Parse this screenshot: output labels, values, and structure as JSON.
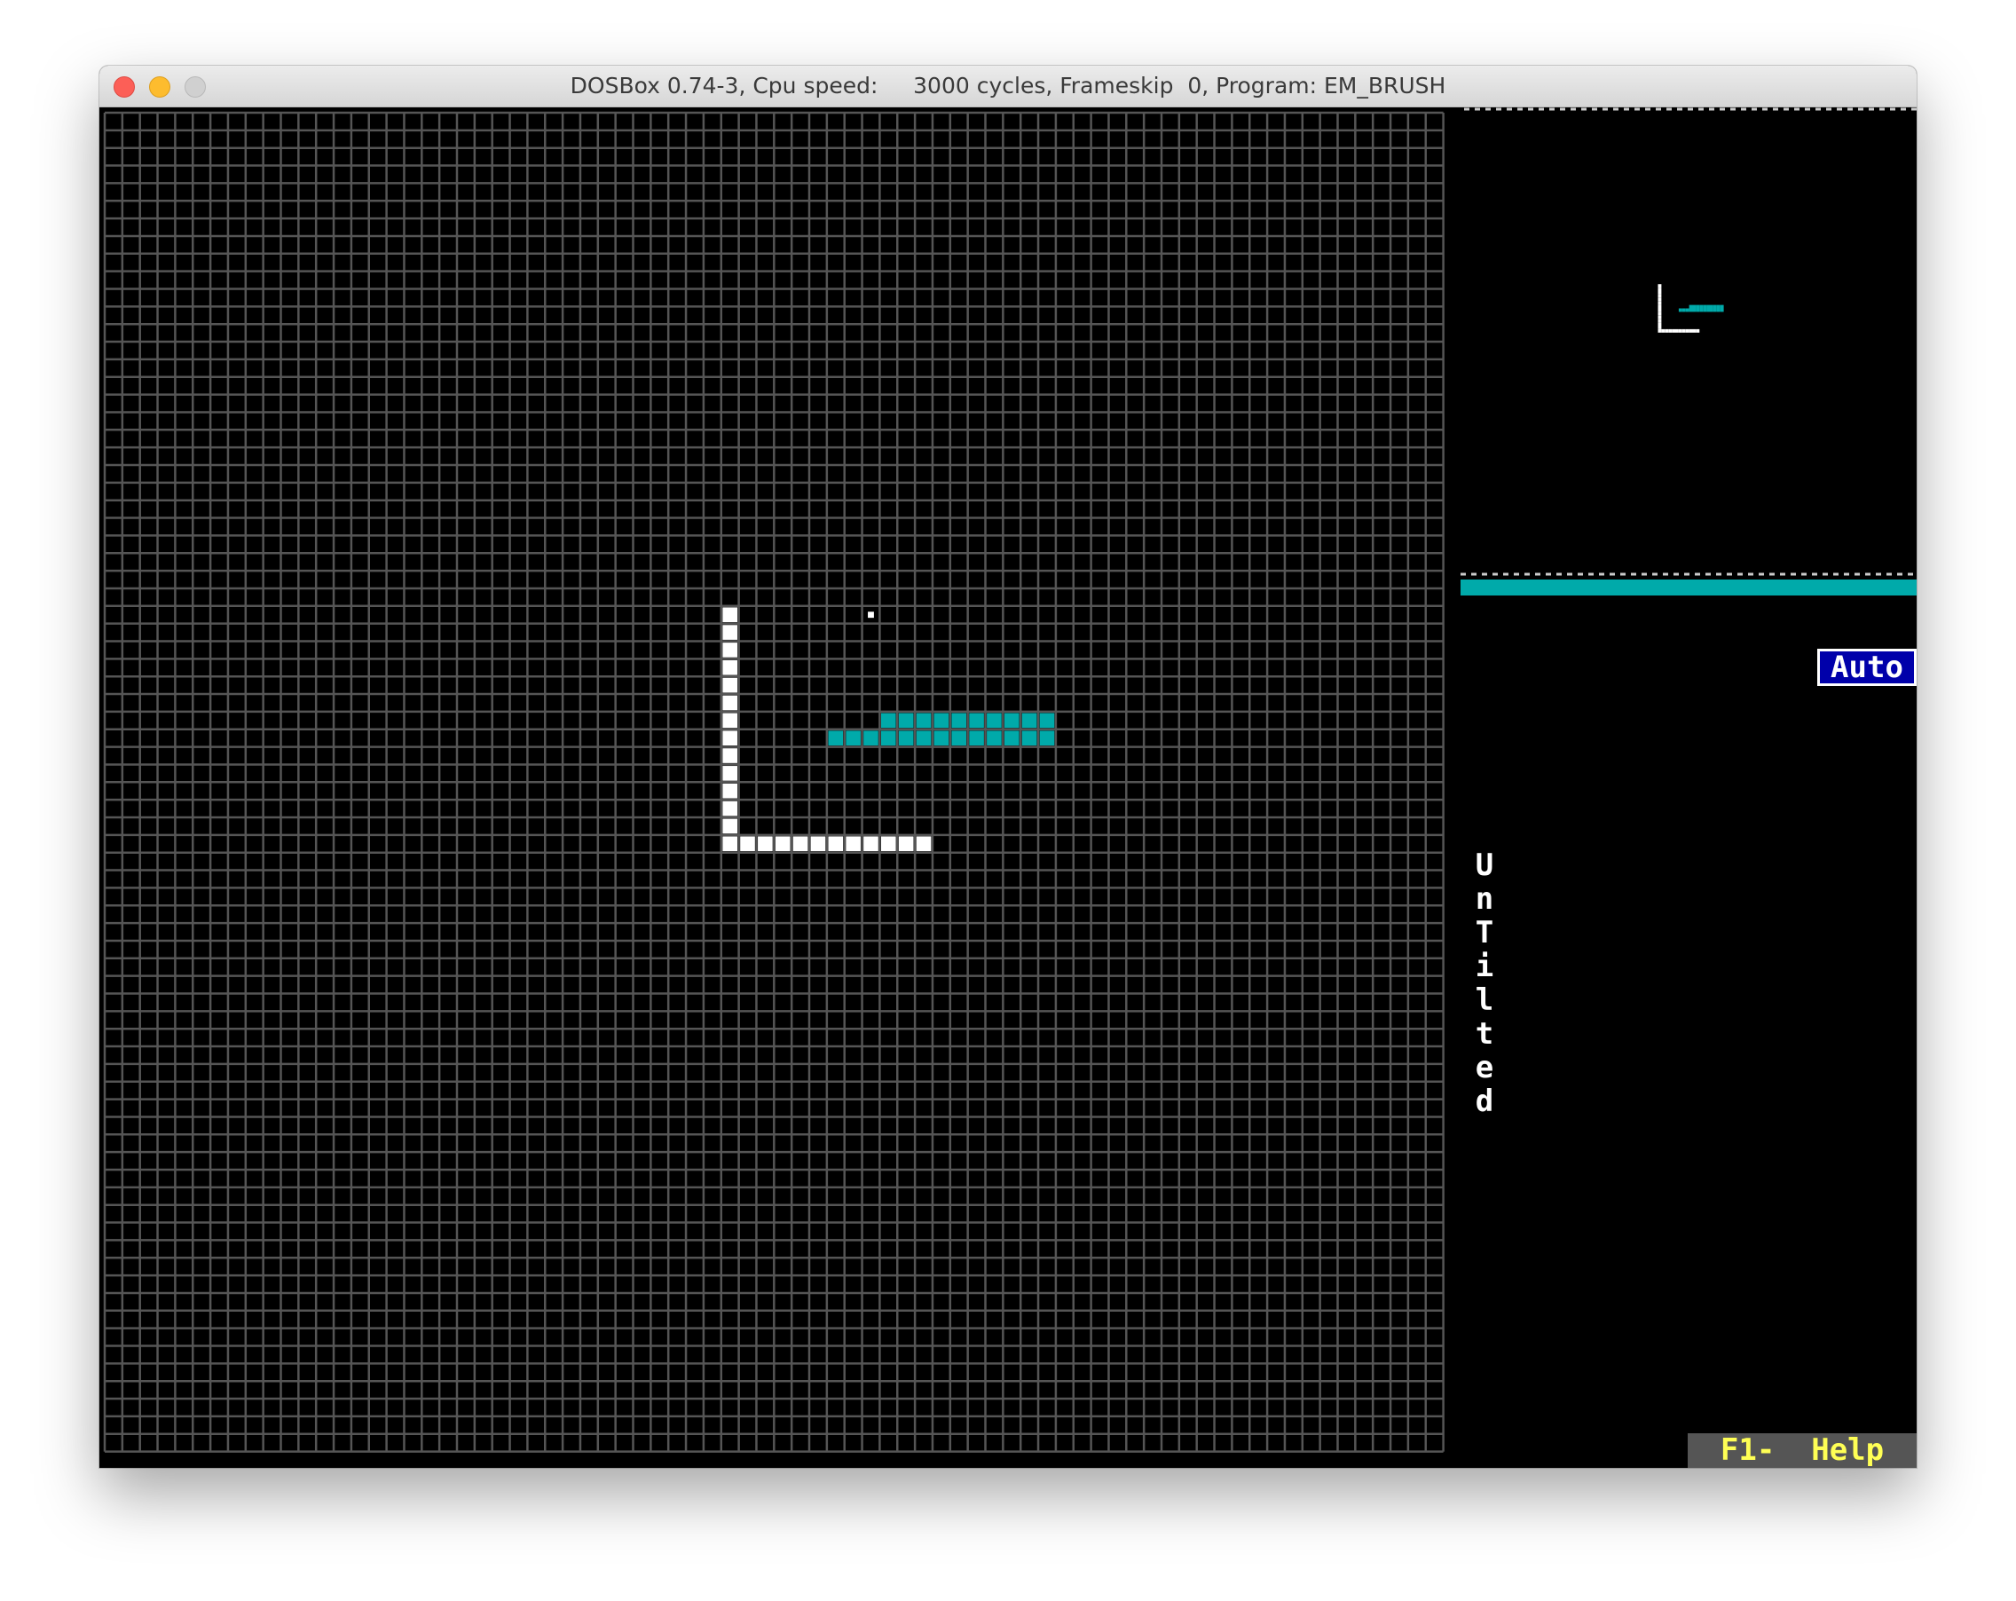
{
  "window": {
    "title": "DOSBox 0.74-3, Cpu speed:     3000 cycles, Frameskip  0, Program: EM_BRUSH"
  },
  "editor": {
    "grid_columns": 76,
    "grid_rows": 76,
    "colors": {
      "background": "#000000",
      "grid_line": "#555555",
      "white": "#ffffff",
      "cyan": "#00aaaa",
      "badge_blue": "#0000aa",
      "help_bg": "#555555",
      "help_text": "#ffff55"
    },
    "cursor_cell": [
      43,
      28
    ],
    "white_cells": [
      [
        35,
        28
      ],
      [
        35,
        29
      ],
      [
        35,
        30
      ],
      [
        35,
        31
      ],
      [
        35,
        32
      ],
      [
        35,
        33
      ],
      [
        35,
        34
      ],
      [
        35,
        35
      ],
      [
        35,
        36
      ],
      [
        35,
        37
      ],
      [
        35,
        38
      ],
      [
        35,
        39
      ],
      [
        35,
        40
      ],
      [
        35,
        41
      ],
      [
        36,
        41
      ],
      [
        37,
        41
      ],
      [
        38,
        41
      ],
      [
        39,
        41
      ],
      [
        40,
        41
      ],
      [
        41,
        41
      ],
      [
        42,
        41
      ],
      [
        43,
        41
      ],
      [
        44,
        41
      ],
      [
        45,
        41
      ],
      [
        46,
        41
      ]
    ],
    "cyan_cells": [
      [
        44,
        34
      ],
      [
        45,
        34
      ],
      [
        46,
        34
      ],
      [
        47,
        34
      ],
      [
        48,
        34
      ],
      [
        49,
        34
      ],
      [
        50,
        34
      ],
      [
        51,
        34
      ],
      [
        52,
        34
      ],
      [
        53,
        34
      ],
      [
        41,
        35
      ],
      [
        42,
        35
      ],
      [
        43,
        35
      ],
      [
        44,
        35
      ],
      [
        45,
        35
      ],
      [
        46,
        35
      ],
      [
        47,
        35
      ],
      [
        48,
        35
      ],
      [
        49,
        35
      ],
      [
        50,
        35
      ],
      [
        51,
        35
      ],
      [
        52,
        35
      ],
      [
        53,
        35
      ]
    ]
  },
  "side_panel": {
    "mode_label": "Auto",
    "filename_label": "UnTilted",
    "help_label": "F1-  Help"
  }
}
